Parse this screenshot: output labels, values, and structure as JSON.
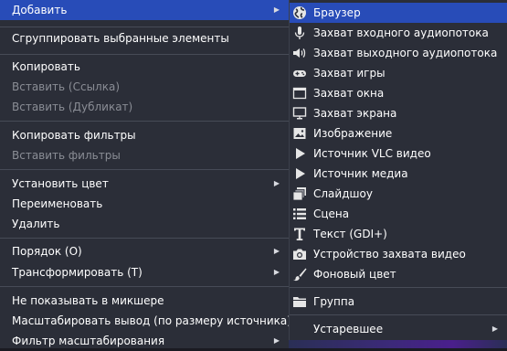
{
  "main_menu": {
    "add": "Добавить",
    "group_selected": "Сгруппировать выбранные элементы",
    "copy": "Копировать",
    "paste_ref": "Вставить (Ссылка)",
    "paste_dup": "Вставить (Дубликат)",
    "copy_filters": "Копировать фильтры",
    "paste_filters": "Вставить фильтры",
    "set_color": "Установить цвет",
    "rename": "Переименовать",
    "delete": "Удалить",
    "order": "Порядок (O)",
    "transform": "Трансформировать (T)",
    "hide_in_mixer": "Не показывать в микшере",
    "resize_output": "Масштабировать вывод (по размеру источника)",
    "scale_filter": "Фильтр масштабирования"
  },
  "sub_menu": {
    "items": [
      {
        "label": "Браузер",
        "icon": "globe-icon"
      },
      {
        "label": "Захват входного аудиопотока",
        "icon": "microphone-icon"
      },
      {
        "label": "Захват выходного аудиопотока",
        "icon": "speaker-icon"
      },
      {
        "label": "Захват игры",
        "icon": "gamepad-icon"
      },
      {
        "label": "Захват окна",
        "icon": "window-icon"
      },
      {
        "label": "Захват экрана",
        "icon": "monitor-icon"
      },
      {
        "label": "Изображение",
        "icon": "image-icon"
      },
      {
        "label": "Источник VLC видео",
        "icon": "play-icon"
      },
      {
        "label": "Источник медиа",
        "icon": "play-icon"
      },
      {
        "label": "Слайдшоу",
        "icon": "slideshow-icon"
      },
      {
        "label": "Сцена",
        "icon": "list-icon"
      },
      {
        "label": "Текст (GDI+)",
        "icon": "text-icon"
      },
      {
        "label": "Устройство захвата видео",
        "icon": "camera-icon"
      },
      {
        "label": "Фоновый цвет",
        "icon": "brush-icon"
      }
    ],
    "group": "Группа",
    "deprecated": "Устаревшее"
  },
  "colors": {
    "menu_bg": "#2b2e38",
    "highlight": "#284cb8",
    "separator": "#474b57",
    "disabled_text": "#8a8d95"
  }
}
